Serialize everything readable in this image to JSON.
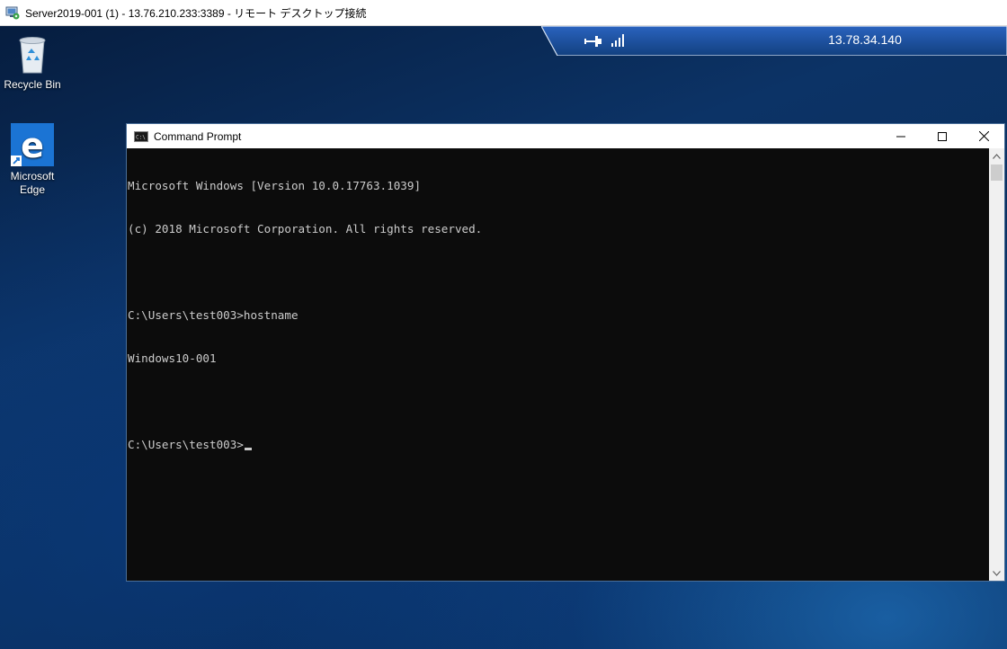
{
  "rdp_window": {
    "title": "Server2019-001 (1) - 13.76.210.233:3389 - リモート デスクトップ接続",
    "icon": "remote-desktop-icon"
  },
  "connection_bar": {
    "ip": "13.78.34.140",
    "pin_icon": "pin-icon",
    "signal_icon": "signal-strength-icon"
  },
  "desktop_icons": [
    {
      "label": "Recycle Bin",
      "icon": "recycle-bin-icon"
    },
    {
      "label": "Microsoft\nEdge",
      "label_line1": "Microsoft",
      "label_line2": "Edge",
      "icon": "edge-icon"
    }
  ],
  "cmd_window": {
    "title": "Command Prompt",
    "icon": "cmd-icon",
    "lines": [
      "Microsoft Windows [Version 10.0.17763.1039]",
      "(c) 2018 Microsoft Corporation. All rights reserved.",
      "",
      "C:\\Users\\test003>hostname",
      "Windows10-001",
      "",
      "C:\\Users\\test003>"
    ]
  },
  "colors": {
    "console_bg": "#0c0c0c",
    "console_text": "#cccccc",
    "connection_bar": "#1c4fa0"
  }
}
